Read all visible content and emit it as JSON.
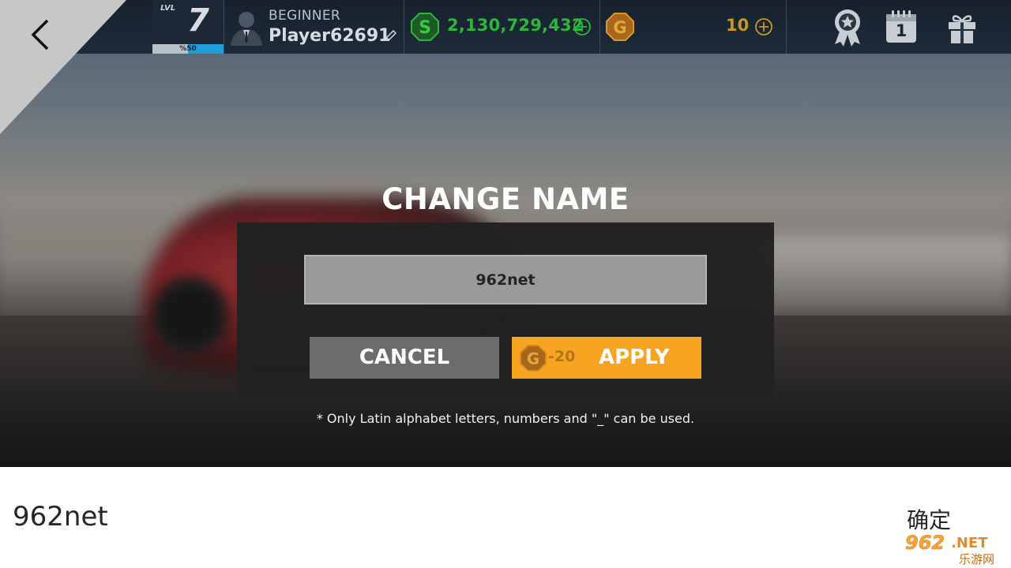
{
  "hud": {
    "level_label": "LVL",
    "level": "7",
    "level_progress_text": "%50",
    "level_progress": 0.5,
    "rank": "BEGINNER",
    "player_name": "Player62691",
    "cash": "2,130,729,432",
    "gold": "10",
    "calendar_day": "1"
  },
  "dialog": {
    "title": "CHANGE NAME",
    "input_value": "962net",
    "cancel_label": "CANCEL",
    "apply_cost": "-20",
    "apply_label": "APPLY",
    "note": "* Only Latin alphabet letters, numbers and \"_\" can be used."
  },
  "ime": {
    "text": "962net",
    "confirm_label": "确定"
  },
  "watermark": {
    "text": "962.NET",
    "subtext": "乐游网"
  },
  "colors": {
    "cash": "#2bb63c",
    "gold": "#c99622",
    "apply_button": "#f6a421",
    "cancel_button": "#6c6c6c",
    "hud_bg": "#182636"
  },
  "icons": [
    "back-arrow-icon",
    "avatar-icon",
    "edit-pencil-icon",
    "cash-coin-icon",
    "plus-circle-icon",
    "gold-coin-icon",
    "achievement-medal-icon",
    "calendar-icon",
    "gift-icon"
  ]
}
